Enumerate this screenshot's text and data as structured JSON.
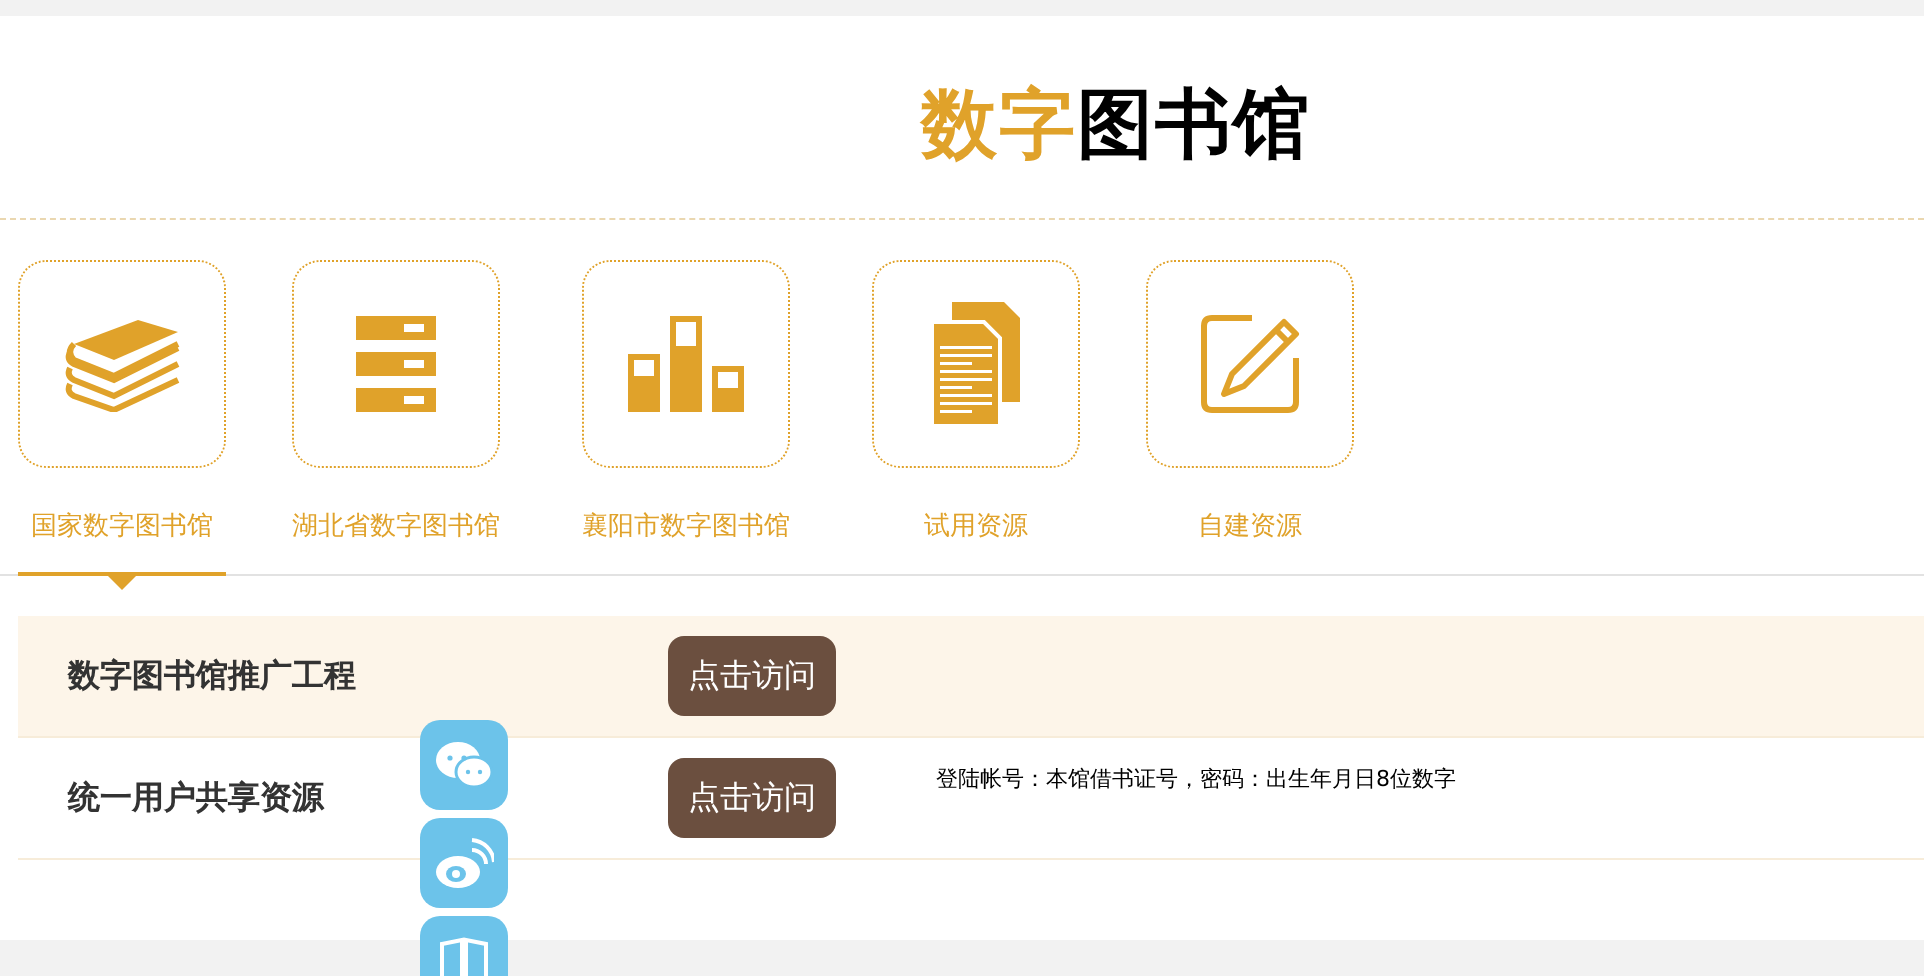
{
  "title": [
    {
      "text": "数字",
      "kind": "accent"
    },
    {
      "text": "图书馆",
      "kind": "plain"
    }
  ],
  "tabs": [
    {
      "label": "国家数字图书馆",
      "kind": "books",
      "selected": true
    },
    {
      "label": "湖北省数字图书馆",
      "kind": "drawers",
      "selected": false
    },
    {
      "label": "襄阳市数字图书馆",
      "kind": "bars",
      "selected": false
    },
    {
      "label": "试用资源",
      "kind": "docs",
      "selected": false
    },
    {
      "label": "自建资源",
      "kind": "edit",
      "selected": false
    }
  ],
  "rows": [
    {
      "name": "数字图书馆推广工程",
      "button": "点击访问",
      "highlighted": true
    },
    {
      "name": "统一用户共享资源",
      "button": "点击访问",
      "note": "登陆帐号：本馆借书证号，密码：出生年月日8位数字",
      "highlighted": false
    }
  ]
}
